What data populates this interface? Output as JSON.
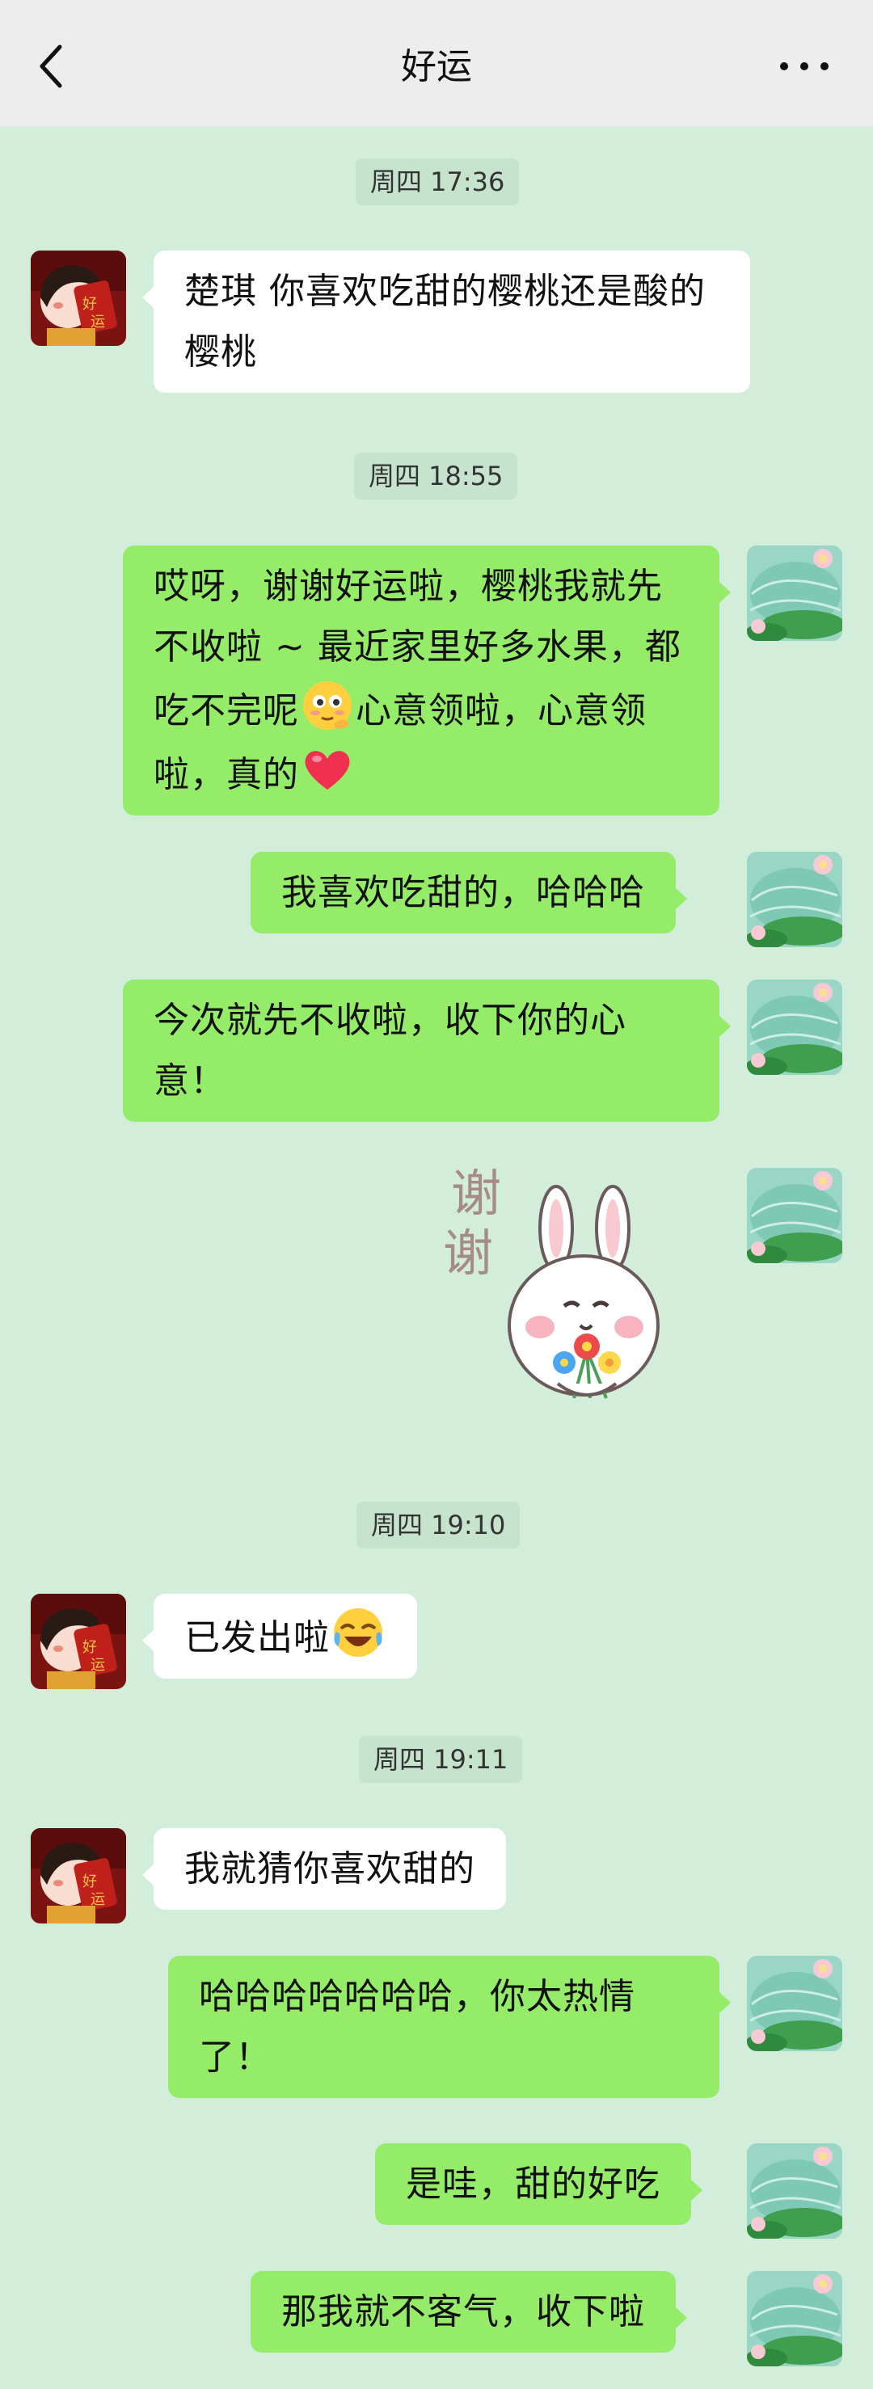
{
  "header": {
    "title": "好运",
    "back_icon": "chevron-left-icon",
    "more_icon": "more-dots-icon"
  },
  "colors": {
    "chat_background": "#d3eddb",
    "outgoing_bubble": "#95ec69",
    "incoming_bubble": "#ffffff",
    "header_background": "#ededed"
  },
  "messages": [
    {
      "type": "time",
      "text": "周四 17:36"
    },
    {
      "type": "incoming",
      "text": "楚琪 你喜欢吃甜的樱桃还是酸的樱桃"
    },
    {
      "type": "time",
      "text": "周四 18:55"
    },
    {
      "type": "outgoing",
      "parts": [
        "哎呀，谢谢好运啦，樱桃我就先不收啦 ~ 最近家里好多水果，都吃不完呢",
        "心意领啦，心意领啦，真的"
      ],
      "emojis": [
        "shy-face-emoji",
        "red-heart-emoji"
      ]
    },
    {
      "type": "outgoing",
      "text": "我喜欢吃甜的，哈哈哈"
    },
    {
      "type": "outgoing",
      "text": "今次就先不收啦，收下你的心意！"
    },
    {
      "type": "outgoing-sticker",
      "text": "谢谢",
      "sticker": "bunny-with-flowers-sticker"
    },
    {
      "type": "time",
      "text": "周四 19:10"
    },
    {
      "type": "incoming",
      "text": "已发出啦",
      "emoji": "laughing-tears-emoji"
    },
    {
      "type": "time",
      "text": "周四 19:11"
    },
    {
      "type": "incoming",
      "text": "我就猜你喜欢甜的"
    },
    {
      "type": "outgoing",
      "text": "哈哈哈哈哈哈哈，你太热情了！"
    },
    {
      "type": "outgoing",
      "text": "是哇，甜的好吃"
    },
    {
      "type": "outgoing",
      "text": "那我就不客气，收下啦"
    }
  ]
}
